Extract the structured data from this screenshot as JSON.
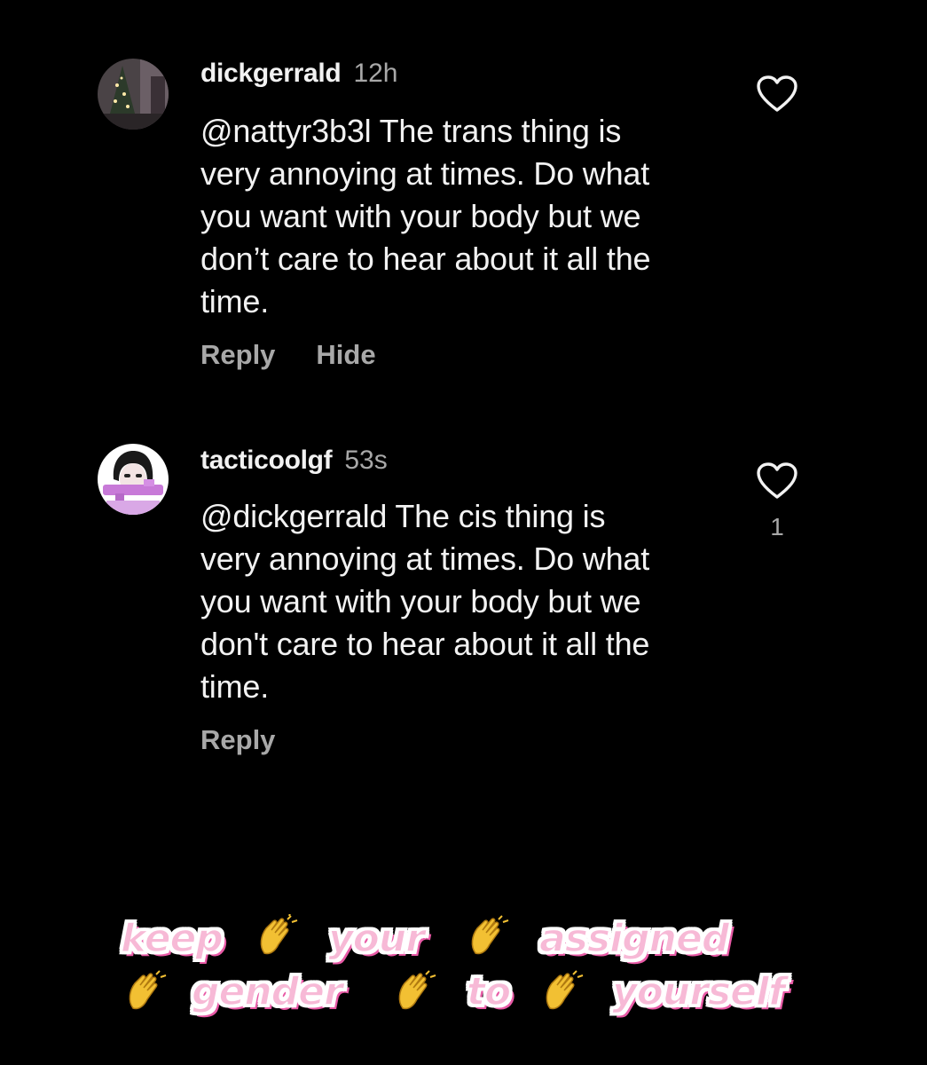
{
  "comments": [
    {
      "username": "dickgerrald",
      "timestamp": "12h",
      "lines": [
        "@nattyr3b3l The trans thing is",
        "very annoying at times. Do what",
        "you want with your body but we",
        "don’t care to hear about it all the",
        "time."
      ],
      "actions": [
        "Reply",
        "Hide"
      ],
      "like_count": ""
    },
    {
      "username": "tacticoolgf",
      "timestamp": "53s",
      "lines": [
        "@dickgerrald The cis thing is",
        "very annoying at times. Do what",
        "you want with your body but we",
        "don't care to hear about it all the",
        "time."
      ],
      "actions": [
        "Reply"
      ],
      "like_count": "1"
    }
  ],
  "caption": {
    "line1": [
      "keep",
      "your",
      "assigned"
    ],
    "line2": [
      "gender",
      "to",
      "yourself"
    ]
  },
  "icons": {
    "like": "heart-outline-icon",
    "clap": "clapping-hands-emoji"
  },
  "colors": {
    "background": "#000000",
    "text": "#f2f2f2",
    "muted": "#a8a8a8",
    "caption_fill": "#f7b9d6",
    "caption_shadow": "#e85aa6"
  }
}
